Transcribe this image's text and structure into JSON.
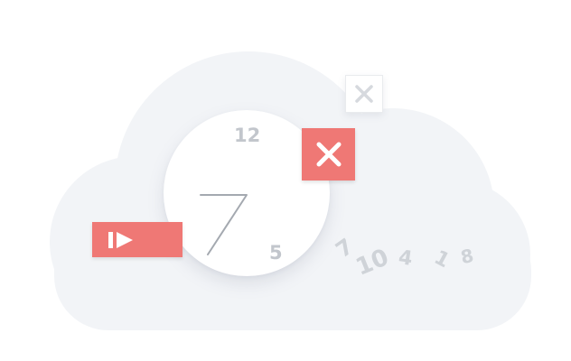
{
  "clock": {
    "numbers": {
      "twelve": "12",
      "five": "5"
    }
  },
  "scattered_numbers": [
    "7",
    "10",
    "4",
    "1",
    "8"
  ],
  "icons": {
    "close_primary": "close-icon",
    "close_secondary": "close-icon",
    "play_step": "play-step-icon"
  },
  "colors": {
    "accent": "#ef7875",
    "cloud": "#f2f4f7",
    "muted_text": "#c2c6cc",
    "icon_light": "#d6d9de"
  }
}
